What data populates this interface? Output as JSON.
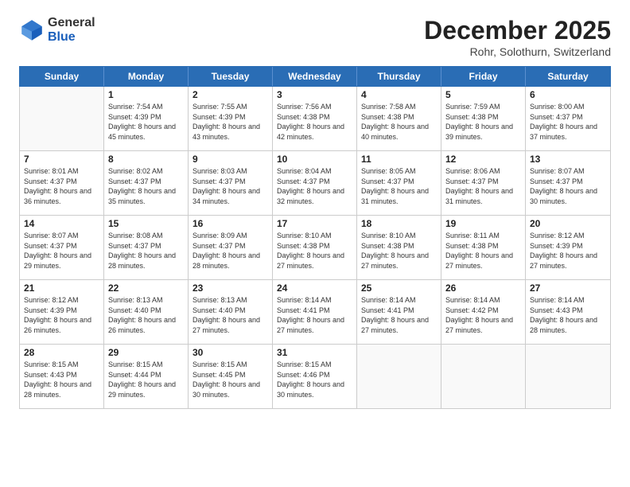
{
  "header": {
    "logo_general": "General",
    "logo_blue": "Blue",
    "month_title": "December 2025",
    "location": "Rohr, Solothurn, Switzerland"
  },
  "weekdays": [
    "Sunday",
    "Monday",
    "Tuesday",
    "Wednesday",
    "Thursday",
    "Friday",
    "Saturday"
  ],
  "weeks": [
    [
      {
        "day": "",
        "sunrise": "",
        "sunset": "",
        "daylight": "",
        "empty": true
      },
      {
        "day": "1",
        "sunrise": "Sunrise: 7:54 AM",
        "sunset": "Sunset: 4:39 PM",
        "daylight": "Daylight: 8 hours and 45 minutes."
      },
      {
        "day": "2",
        "sunrise": "Sunrise: 7:55 AM",
        "sunset": "Sunset: 4:39 PM",
        "daylight": "Daylight: 8 hours and 43 minutes."
      },
      {
        "day": "3",
        "sunrise": "Sunrise: 7:56 AM",
        "sunset": "Sunset: 4:38 PM",
        "daylight": "Daylight: 8 hours and 42 minutes."
      },
      {
        "day": "4",
        "sunrise": "Sunrise: 7:58 AM",
        "sunset": "Sunset: 4:38 PM",
        "daylight": "Daylight: 8 hours and 40 minutes."
      },
      {
        "day": "5",
        "sunrise": "Sunrise: 7:59 AM",
        "sunset": "Sunset: 4:38 PM",
        "daylight": "Daylight: 8 hours and 39 minutes."
      },
      {
        "day": "6",
        "sunrise": "Sunrise: 8:00 AM",
        "sunset": "Sunset: 4:37 PM",
        "daylight": "Daylight: 8 hours and 37 minutes."
      }
    ],
    [
      {
        "day": "7",
        "sunrise": "Sunrise: 8:01 AM",
        "sunset": "Sunset: 4:37 PM",
        "daylight": "Daylight: 8 hours and 36 minutes."
      },
      {
        "day": "8",
        "sunrise": "Sunrise: 8:02 AM",
        "sunset": "Sunset: 4:37 PM",
        "daylight": "Daylight: 8 hours and 35 minutes."
      },
      {
        "day": "9",
        "sunrise": "Sunrise: 8:03 AM",
        "sunset": "Sunset: 4:37 PM",
        "daylight": "Daylight: 8 hours and 34 minutes."
      },
      {
        "day": "10",
        "sunrise": "Sunrise: 8:04 AM",
        "sunset": "Sunset: 4:37 PM",
        "daylight": "Daylight: 8 hours and 32 minutes."
      },
      {
        "day": "11",
        "sunrise": "Sunrise: 8:05 AM",
        "sunset": "Sunset: 4:37 PM",
        "daylight": "Daylight: 8 hours and 31 minutes."
      },
      {
        "day": "12",
        "sunrise": "Sunrise: 8:06 AM",
        "sunset": "Sunset: 4:37 PM",
        "daylight": "Daylight: 8 hours and 31 minutes."
      },
      {
        "day": "13",
        "sunrise": "Sunrise: 8:07 AM",
        "sunset": "Sunset: 4:37 PM",
        "daylight": "Daylight: 8 hours and 30 minutes."
      }
    ],
    [
      {
        "day": "14",
        "sunrise": "Sunrise: 8:07 AM",
        "sunset": "Sunset: 4:37 PM",
        "daylight": "Daylight: 8 hours and 29 minutes."
      },
      {
        "day": "15",
        "sunrise": "Sunrise: 8:08 AM",
        "sunset": "Sunset: 4:37 PM",
        "daylight": "Daylight: 8 hours and 28 minutes."
      },
      {
        "day": "16",
        "sunrise": "Sunrise: 8:09 AM",
        "sunset": "Sunset: 4:37 PM",
        "daylight": "Daylight: 8 hours and 28 minutes."
      },
      {
        "day": "17",
        "sunrise": "Sunrise: 8:10 AM",
        "sunset": "Sunset: 4:38 PM",
        "daylight": "Daylight: 8 hours and 27 minutes."
      },
      {
        "day": "18",
        "sunrise": "Sunrise: 8:10 AM",
        "sunset": "Sunset: 4:38 PM",
        "daylight": "Daylight: 8 hours and 27 minutes."
      },
      {
        "day": "19",
        "sunrise": "Sunrise: 8:11 AM",
        "sunset": "Sunset: 4:38 PM",
        "daylight": "Daylight: 8 hours and 27 minutes."
      },
      {
        "day": "20",
        "sunrise": "Sunrise: 8:12 AM",
        "sunset": "Sunset: 4:39 PM",
        "daylight": "Daylight: 8 hours and 27 minutes."
      }
    ],
    [
      {
        "day": "21",
        "sunrise": "Sunrise: 8:12 AM",
        "sunset": "Sunset: 4:39 PM",
        "daylight": "Daylight: 8 hours and 26 minutes."
      },
      {
        "day": "22",
        "sunrise": "Sunrise: 8:13 AM",
        "sunset": "Sunset: 4:40 PM",
        "daylight": "Daylight: 8 hours and 26 minutes."
      },
      {
        "day": "23",
        "sunrise": "Sunrise: 8:13 AM",
        "sunset": "Sunset: 4:40 PM",
        "daylight": "Daylight: 8 hours and 27 minutes."
      },
      {
        "day": "24",
        "sunrise": "Sunrise: 8:14 AM",
        "sunset": "Sunset: 4:41 PM",
        "daylight": "Daylight: 8 hours and 27 minutes."
      },
      {
        "day": "25",
        "sunrise": "Sunrise: 8:14 AM",
        "sunset": "Sunset: 4:41 PM",
        "daylight": "Daylight: 8 hours and 27 minutes."
      },
      {
        "day": "26",
        "sunrise": "Sunrise: 8:14 AM",
        "sunset": "Sunset: 4:42 PM",
        "daylight": "Daylight: 8 hours and 27 minutes."
      },
      {
        "day": "27",
        "sunrise": "Sunrise: 8:14 AM",
        "sunset": "Sunset: 4:43 PM",
        "daylight": "Daylight: 8 hours and 28 minutes."
      }
    ],
    [
      {
        "day": "28",
        "sunrise": "Sunrise: 8:15 AM",
        "sunset": "Sunset: 4:43 PM",
        "daylight": "Daylight: 8 hours and 28 minutes."
      },
      {
        "day": "29",
        "sunrise": "Sunrise: 8:15 AM",
        "sunset": "Sunset: 4:44 PM",
        "daylight": "Daylight: 8 hours and 29 minutes."
      },
      {
        "day": "30",
        "sunrise": "Sunrise: 8:15 AM",
        "sunset": "Sunset: 4:45 PM",
        "daylight": "Daylight: 8 hours and 30 minutes."
      },
      {
        "day": "31",
        "sunrise": "Sunrise: 8:15 AM",
        "sunset": "Sunset: 4:46 PM",
        "daylight": "Daylight: 8 hours and 30 minutes."
      },
      {
        "day": "",
        "sunrise": "",
        "sunset": "",
        "daylight": "",
        "empty": true
      },
      {
        "day": "",
        "sunrise": "",
        "sunset": "",
        "daylight": "",
        "empty": true
      },
      {
        "day": "",
        "sunrise": "",
        "sunset": "",
        "daylight": "",
        "empty": true
      }
    ]
  ]
}
